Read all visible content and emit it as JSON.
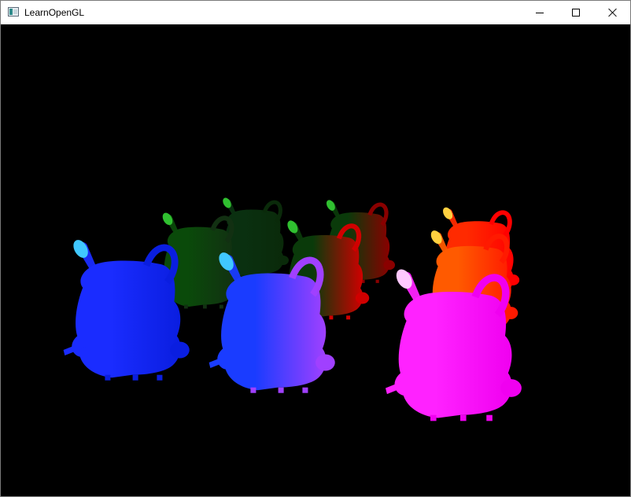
{
  "window": {
    "title": "LearnOpenGL",
    "icon": "app-window-icon",
    "controls": {
      "minimize": "minimize-icon",
      "maximize": "maximize-icon",
      "close": "close-icon"
    }
  },
  "scene": {
    "background": "#000000",
    "object": "nanosuit-backpack-model",
    "instances": [
      {
        "name": "backpack-front-left",
        "colors": [
          "#1a2cff",
          "#0a1ee0"
        ]
      },
      {
        "name": "backpack-front-center",
        "colors": [
          "#1a3cff",
          "#a040ff"
        ]
      },
      {
        "name": "backpack-front-right",
        "colors": [
          "#ff22ff",
          "#f000f0"
        ]
      },
      {
        "name": "backpack-mid-left",
        "colors": [
          "#0a4a0a",
          "#123012"
        ]
      },
      {
        "name": "backpack-mid-center",
        "colors": [
          "#0a3a0a",
          "#d00000"
        ]
      },
      {
        "name": "backpack-mid-right",
        "colors": [
          "#ff5a00",
          "#ff1a00"
        ]
      },
      {
        "name": "backpack-back-left",
        "colors": [
          "#0a3010",
          "#0a2a0a"
        ]
      },
      {
        "name": "backpack-back-center",
        "colors": [
          "#0a3a0a",
          "#8a0000"
        ]
      },
      {
        "name": "backpack-back-right",
        "colors": [
          "#ff2a00",
          "#ff0000"
        ]
      }
    ]
  }
}
